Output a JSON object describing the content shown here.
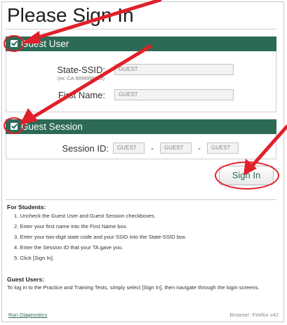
{
  "page": {
    "title": "Please Sign In"
  },
  "guest_user": {
    "section_label": "Guest User",
    "checked": true,
    "state_ssid_label": "State-SSID:",
    "state_ssid_hint": "(ex: CA-9999999123)",
    "state_ssid_value": "GUEST",
    "first_name_label": "First Name:",
    "first_name_value": "GUEST"
  },
  "guest_session": {
    "section_label": "Guest Session",
    "checked": true,
    "session_id_label": "Session ID:",
    "session_parts": [
      "GUEST",
      "GUEST",
      "GUEST"
    ],
    "separator": "-"
  },
  "sign_in_button": {
    "label": "Sign In"
  },
  "instructions": {
    "students_heading": "For Students:",
    "steps": [
      "1. Uncheck the Guest User and Guest Session checkboxes.",
      "2. Enter your first name into the First Name box.",
      "3. Enter your two-digit state code and your SSID into the State-SSID box.",
      "4. Enter the Session ID that your TA gave you.",
      "5. Click [Sign In]."
    ],
    "guests_heading": "Guest Users:",
    "guests_text": "To log in to the Practice and Training Tests, simply select [Sign In], then navigate through the login screens."
  },
  "footer": {
    "diagnostics_link": "Run Diagnostics",
    "browser_info": "Browser: Firefox v42"
  },
  "colors": {
    "brand": "#2d6a55",
    "annotation": "#e0202a"
  }
}
